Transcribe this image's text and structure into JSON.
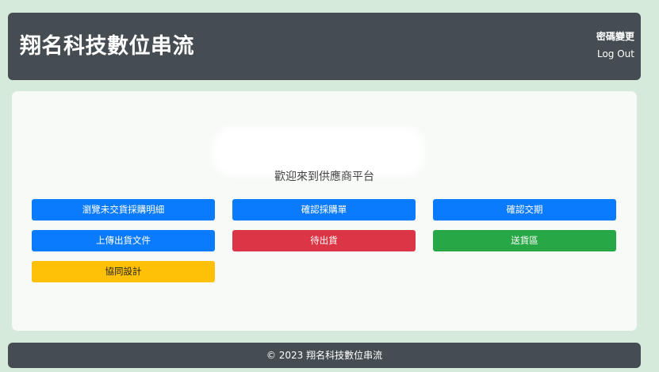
{
  "header": {
    "title": "翔名科技數位串流",
    "change_password": "密碼變更",
    "logout": "Log Out"
  },
  "main": {
    "welcome": "歡迎來到供應商平台",
    "buttons": [
      {
        "label": "瀏覽未交貨採購明細",
        "color": "#0b7bfd"
      },
      {
        "label": "確認採購單",
        "color": "#0b7bfd"
      },
      {
        "label": "確認交期",
        "color": "#0b7bfd"
      },
      {
        "label": "上傳出貨文件",
        "color": "#0b7bfd"
      },
      {
        "label": "待出貨",
        "color": "#dc3545"
      },
      {
        "label": "送貨區",
        "color": "#27a745"
      },
      {
        "label": "協同設計",
        "color": "#ffc107"
      }
    ]
  },
  "footer": {
    "text": "© 2023 翔名科技數位串流"
  },
  "colors": {
    "background": "#d6eadb",
    "header": "#454d52",
    "card": "#f8faf8"
  }
}
